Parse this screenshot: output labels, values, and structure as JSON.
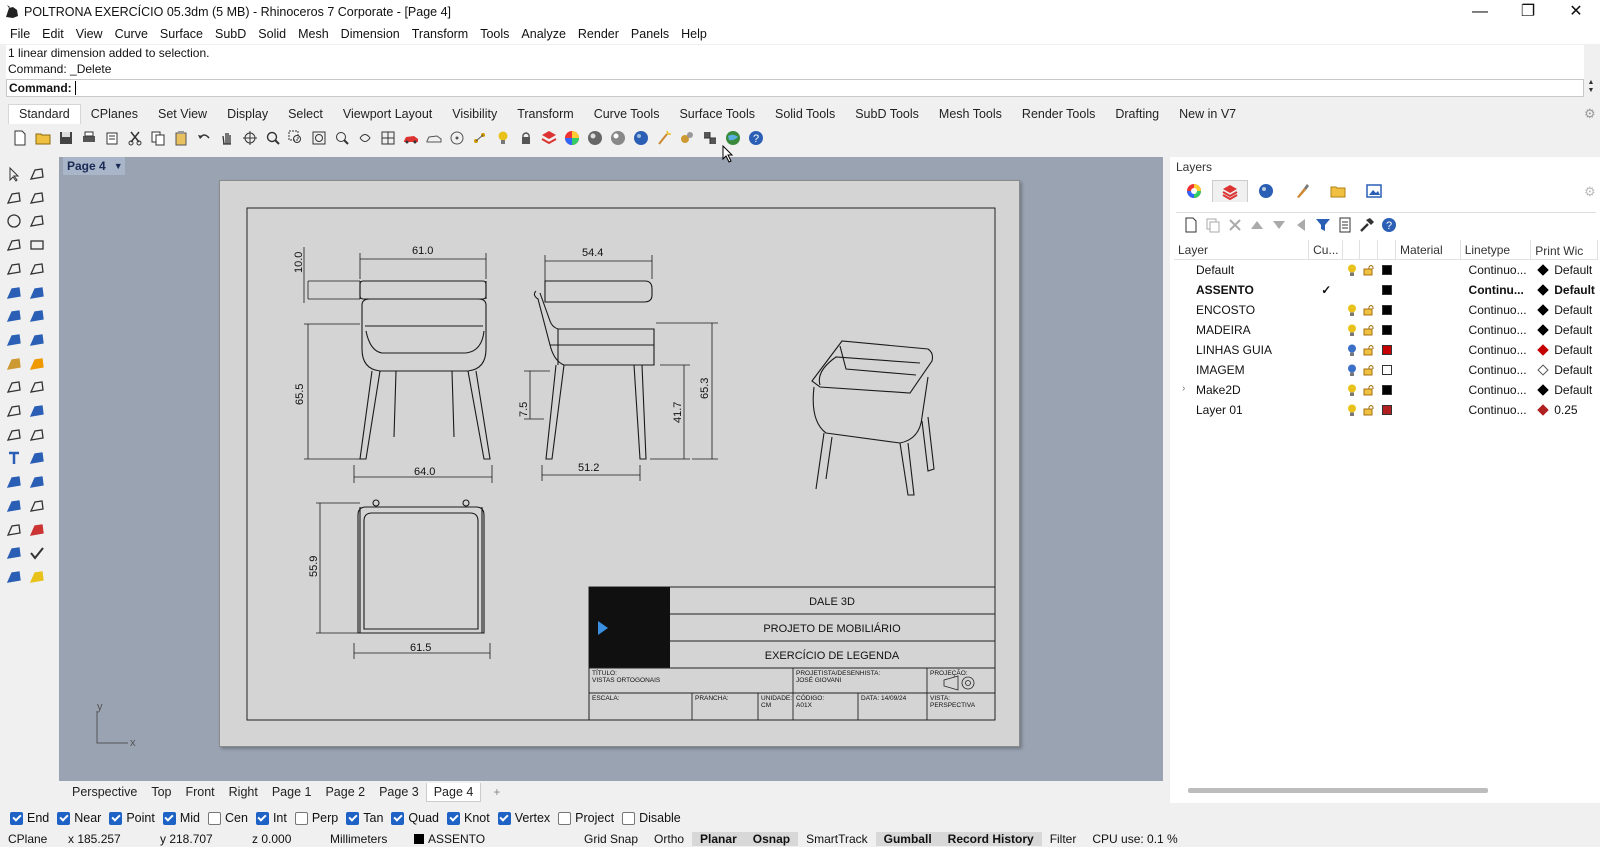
{
  "window": {
    "title": "POLTRONA EXERCÍCIO 05.3dm (5 MB) - Rhinoceros 7 Corporate - [Page 4]",
    "minimize": "—",
    "restore": "❐",
    "close": "✕"
  },
  "menu": [
    "File",
    "Edit",
    "View",
    "Curve",
    "Surface",
    "SubD",
    "Solid",
    "Mesh",
    "Dimension",
    "Transform",
    "Tools",
    "Analyze",
    "Render",
    "Panels",
    "Help"
  ],
  "command": {
    "history_1": "1 linear dimension added to selection.",
    "history_2": "Command: _Delete",
    "prompt": "Command:"
  },
  "toolbar_tabs": [
    "Standard",
    "CPlanes",
    "Set View",
    "Display",
    "Select",
    "Viewport Layout",
    "Visibility",
    "Transform",
    "Curve Tools",
    "Surface Tools",
    "Solid Tools",
    "SubD Tools",
    "Mesh Tools",
    "Render Tools",
    "Drafting",
    "New in V7"
  ],
  "active_toolbar_tab": "Standard",
  "viewport": {
    "page_tab": "Page 4",
    "axis_y": "y",
    "axis_x": "x"
  },
  "drawing": {
    "dims": {
      "front_width": "61.0",
      "front_top": "10.0",
      "front_height": "65.5",
      "front_base": "64.0",
      "side_top_width": "54.4",
      "side_seat_h": "7.5",
      "side_leg_h": "41.7",
      "side_height": "65.3",
      "side_base": "51.2",
      "top_depth": "55.9",
      "top_width": "61.5"
    },
    "titleblock": {
      "logo": "DALE 3D",
      "line1": "DALE 3D",
      "line2": "PROJETO DE MOBILIÁRIO",
      "line3": "EXERCÍCIO DE LEGENDA",
      "titulo_label": "TÍTULO:",
      "titulo_value": "VISTAS ORTOGONAIS",
      "projetista_label": "PROJETISTA/DESENHISTA:",
      "projetista_value": "JOSÉ GIOVANI",
      "projecao_label": "PROJEÇÃO:",
      "escala_label": "ESCALA:",
      "prancha_label": "PRANCHA:",
      "unidade_label": "UNIDADE:",
      "unidade_value": "CM",
      "codigo_label": "CÓDIGO:",
      "codigo_value": "A01X",
      "data_label": "DATA: 14/09/24",
      "vista_label": "VISTA:",
      "vista_value": "PERSPECTIVA"
    }
  },
  "view_tabs": [
    "Perspective",
    "Top",
    "Front",
    "Right",
    "Page 1",
    "Page 2",
    "Page 3",
    "Page 4"
  ],
  "active_view_tab": "Page 4",
  "layers_panel": {
    "title": "Layers",
    "columns": [
      "Layer",
      "Cu...",
      "",
      "",
      "",
      "Material",
      "Linetype",
      "Print Wic"
    ],
    "rows": [
      {
        "name": "Default",
        "current": "",
        "bulb": "#e8c21a",
        "lock": true,
        "color": "#000000",
        "linetype": "Continuo...",
        "print_width": "Default",
        "pw_color": "#000000",
        "bold": false
      },
      {
        "name": "ASSENTO",
        "current": "✓",
        "bulb": "",
        "lock": false,
        "color": "#000000",
        "linetype": "Continu...",
        "print_width": "Default",
        "pw_color": "#000000",
        "bold": true
      },
      {
        "name": "ENCOSTO",
        "current": "",
        "bulb": "#e8c21a",
        "lock": true,
        "color": "#000000",
        "linetype": "Continuo...",
        "print_width": "Default",
        "pw_color": "#000000",
        "bold": false
      },
      {
        "name": "MADEIRA",
        "current": "",
        "bulb": "#e8c21a",
        "lock": true,
        "color": "#000000",
        "linetype": "Continuo...",
        "print_width": "Default",
        "pw_color": "#000000",
        "bold": false
      },
      {
        "name": "LINHAS GUIA",
        "current": "",
        "bulb": "#3a70c8",
        "lock": true,
        "color": "#c40000",
        "linetype": "Continuo...",
        "print_width": "Default",
        "pw_color": "#c40000",
        "bold": false
      },
      {
        "name": "IMAGEM",
        "current": "",
        "bulb": "#3a70c8",
        "lock": true,
        "color": "#ffffff",
        "linetype": "Continuo...",
        "print_width": "Default",
        "pw_color": "#ffffff",
        "bold": false
      },
      {
        "name": "Make2D",
        "current": "",
        "bulb": "#e8c21a",
        "lock": true,
        "color": "#000000",
        "linetype": "Continuo...",
        "print_width": "Default",
        "pw_color": "#000000",
        "bold": false,
        "expandable": true
      },
      {
        "name": "Layer 01",
        "current": "",
        "bulb": "#e8c21a",
        "lock": true,
        "color": "#b02020",
        "linetype": "Continuo...",
        "print_width": "0.25",
        "pw_color": "#b02020",
        "bold": false
      }
    ]
  },
  "osnaps": [
    {
      "label": "End",
      "on": true
    },
    {
      "label": "Near",
      "on": true
    },
    {
      "label": "Point",
      "on": true
    },
    {
      "label": "Mid",
      "on": true
    },
    {
      "label": "Cen",
      "on": false
    },
    {
      "label": "Int",
      "on": true
    },
    {
      "label": "Perp",
      "on": false
    },
    {
      "label": "Tan",
      "on": true
    },
    {
      "label": "Quad",
      "on": true
    },
    {
      "label": "Knot",
      "on": true
    },
    {
      "label": "Vertex",
      "on": true
    },
    {
      "label": "Project",
      "on": false
    },
    {
      "label": "Disable",
      "on": false
    }
  ],
  "status": {
    "cplane": "CPlane",
    "x": "x 185.257",
    "y": "y 218.707",
    "z": "z 0.000",
    "units": "Millimeters",
    "layer": "ASSENTO",
    "grid_snap": "Grid Snap",
    "ortho": "Ortho",
    "planar": "Planar",
    "osnap": "Osnap",
    "smarttrack": "SmartTrack",
    "gumball": "Gumball",
    "record_history": "Record History",
    "filter": "Filter",
    "cpu": "CPU use: 0.1 %"
  }
}
